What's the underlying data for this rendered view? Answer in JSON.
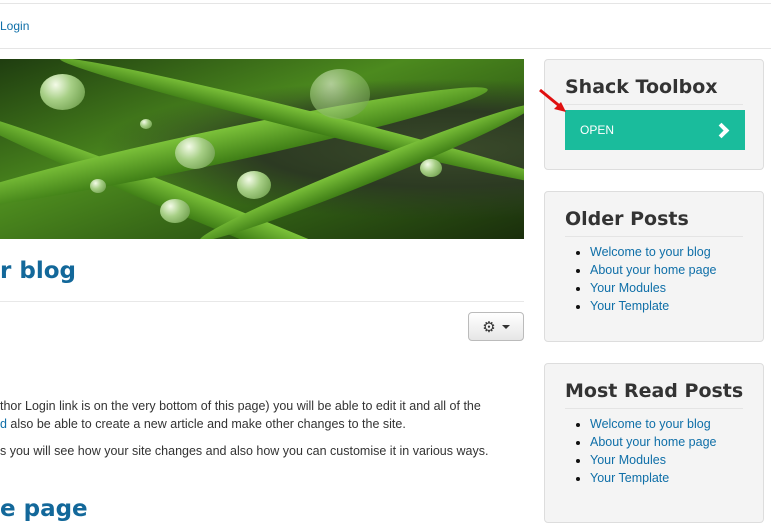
{
  "nav": {
    "login": "Login"
  },
  "article": {
    "title": "r blog",
    "paragraph1_line1": "thor Login link is on the very bottom of this page) you will be able to edit it and all of the",
    "paragraph1_line2_link": "d",
    "paragraph1_line2": " also be able to create a new article and make other changes to the site.",
    "paragraph2": "s you will see how your site changes and also how you can customise it in various ways.",
    "next_heading": "e page",
    "tools_icon": "gear-icon"
  },
  "sidebar": {
    "toolbox": {
      "title": "Shack Toolbox",
      "open_label": "OPEN",
      "accent": "#1abc9c"
    },
    "older_posts": {
      "title": "Older Posts",
      "items": [
        "Welcome to your blog",
        "About your home page",
        "Your Modules",
        "Your Template"
      ]
    },
    "most_read": {
      "title": "Most Read Posts",
      "items": [
        "Welcome to your blog",
        "About your home page",
        "Your Modules",
        "Your Template"
      ]
    }
  }
}
